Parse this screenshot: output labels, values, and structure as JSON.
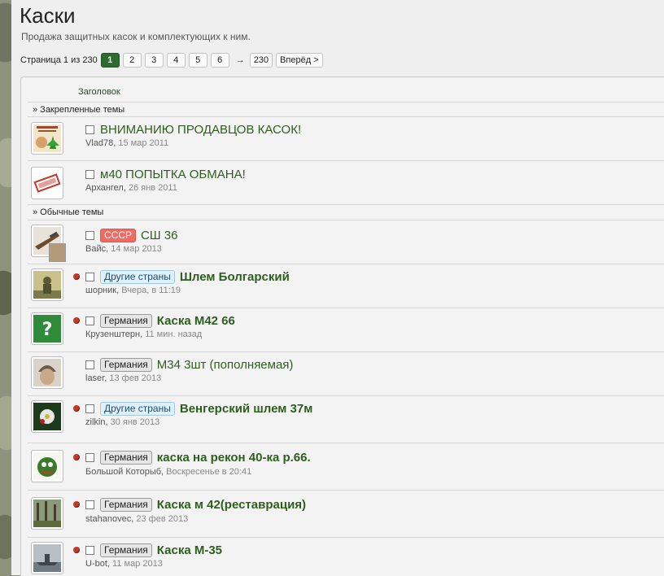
{
  "forum": {
    "title": "Каски",
    "description": "Продажа защитных касок и комплектующих к ним."
  },
  "pagination": {
    "label": "Страница 1 из 230",
    "pages": [
      "1",
      "2",
      "3",
      "4",
      "5",
      "6"
    ],
    "current": "1",
    "arrow": "→",
    "last": "230",
    "next": "Вперёд >"
  },
  "list": {
    "header": "Заголовок",
    "sticky_section": "» Закрепленные темы",
    "normal_section": "» Обычные темы"
  },
  "threads": [
    {
      "prefix": "",
      "prefix_style": "",
      "title": "ВНИМАНИЮ ПРОДАВЦОВ КАСОК!",
      "bold": false,
      "author": "Vlad78",
      "date": "15 мар 2011",
      "unread": false,
      "avatar": "poster-avatar"
    },
    {
      "prefix": "",
      "prefix_style": "",
      "title": "м40 ПОПЫТКА ОБМАНА!",
      "bold": false,
      "author": "Архангел",
      "date": "26 янв 2011",
      "unread": false,
      "avatar": "banned-stamp-avatar"
    },
    {
      "prefix": "СССР",
      "prefix_style": "red",
      "title": "СШ 36",
      "bold": false,
      "author": "Вайс",
      "date": "14 мар 2013",
      "unread": false,
      "avatar": "rifle-avatar"
    },
    {
      "prefix": "Другие страны",
      "prefix_style": "blue",
      "title": "Шлем Болгарский",
      "bold": true,
      "author": "шорник",
      "date": "Вчера, в 11:19",
      "unread": true,
      "avatar": "soldier-avatar"
    },
    {
      "prefix": "Германия",
      "prefix_style": "gray",
      "title": "Каска М42 66",
      "bold": true,
      "author": "Крузенштерн",
      "date": "11 мин. назад",
      "unread": true,
      "avatar": "question-mark-avatar"
    },
    {
      "prefix": "Германия",
      "prefix_style": "gray",
      "title": "М34 3шт (пополняемая)",
      "bold": false,
      "author": "laser",
      "date": "13 фев 2013",
      "unread": false,
      "avatar": "helmet-face-avatar"
    },
    {
      "prefix": "Другие страны",
      "prefix_style": "blue",
      "title": "Венгерский шлем 37м",
      "bold": true,
      "author": "zilkin",
      "date": "30 янв 2013",
      "unread": true,
      "avatar": "edelweiss-avatar"
    },
    {
      "prefix": "Германия",
      "prefix_style": "gray",
      "title": "каска на рекон 40-ка р.66.",
      "bold": true,
      "author": "Большой Которыб",
      "date": "Воскресенье в 20:41",
      "unread": true,
      "avatar": "cartoon-avatar"
    },
    {
      "prefix": "Германия",
      "prefix_style": "gray",
      "title": "Каска м 42(реставрация)",
      "bold": true,
      "author": "stahanovec",
      "date": "23 фев 2013",
      "unread": true,
      "avatar": "forest-avatar"
    },
    {
      "prefix": "Германия",
      "prefix_style": "gray",
      "title": "Каска М-35",
      "bold": true,
      "author": "U-bot",
      "date": "11 мар 2013",
      "unread": true,
      "avatar": "ship-avatar"
    }
  ],
  "colors": {
    "accent": "#2e6b2e",
    "title_link": "#2e5e1f",
    "unread_dot": "#c0392b",
    "prefix_red": "#f26b63",
    "prefix_blue": "#dff0fb",
    "prefix_gray": "#e6e6e6"
  }
}
